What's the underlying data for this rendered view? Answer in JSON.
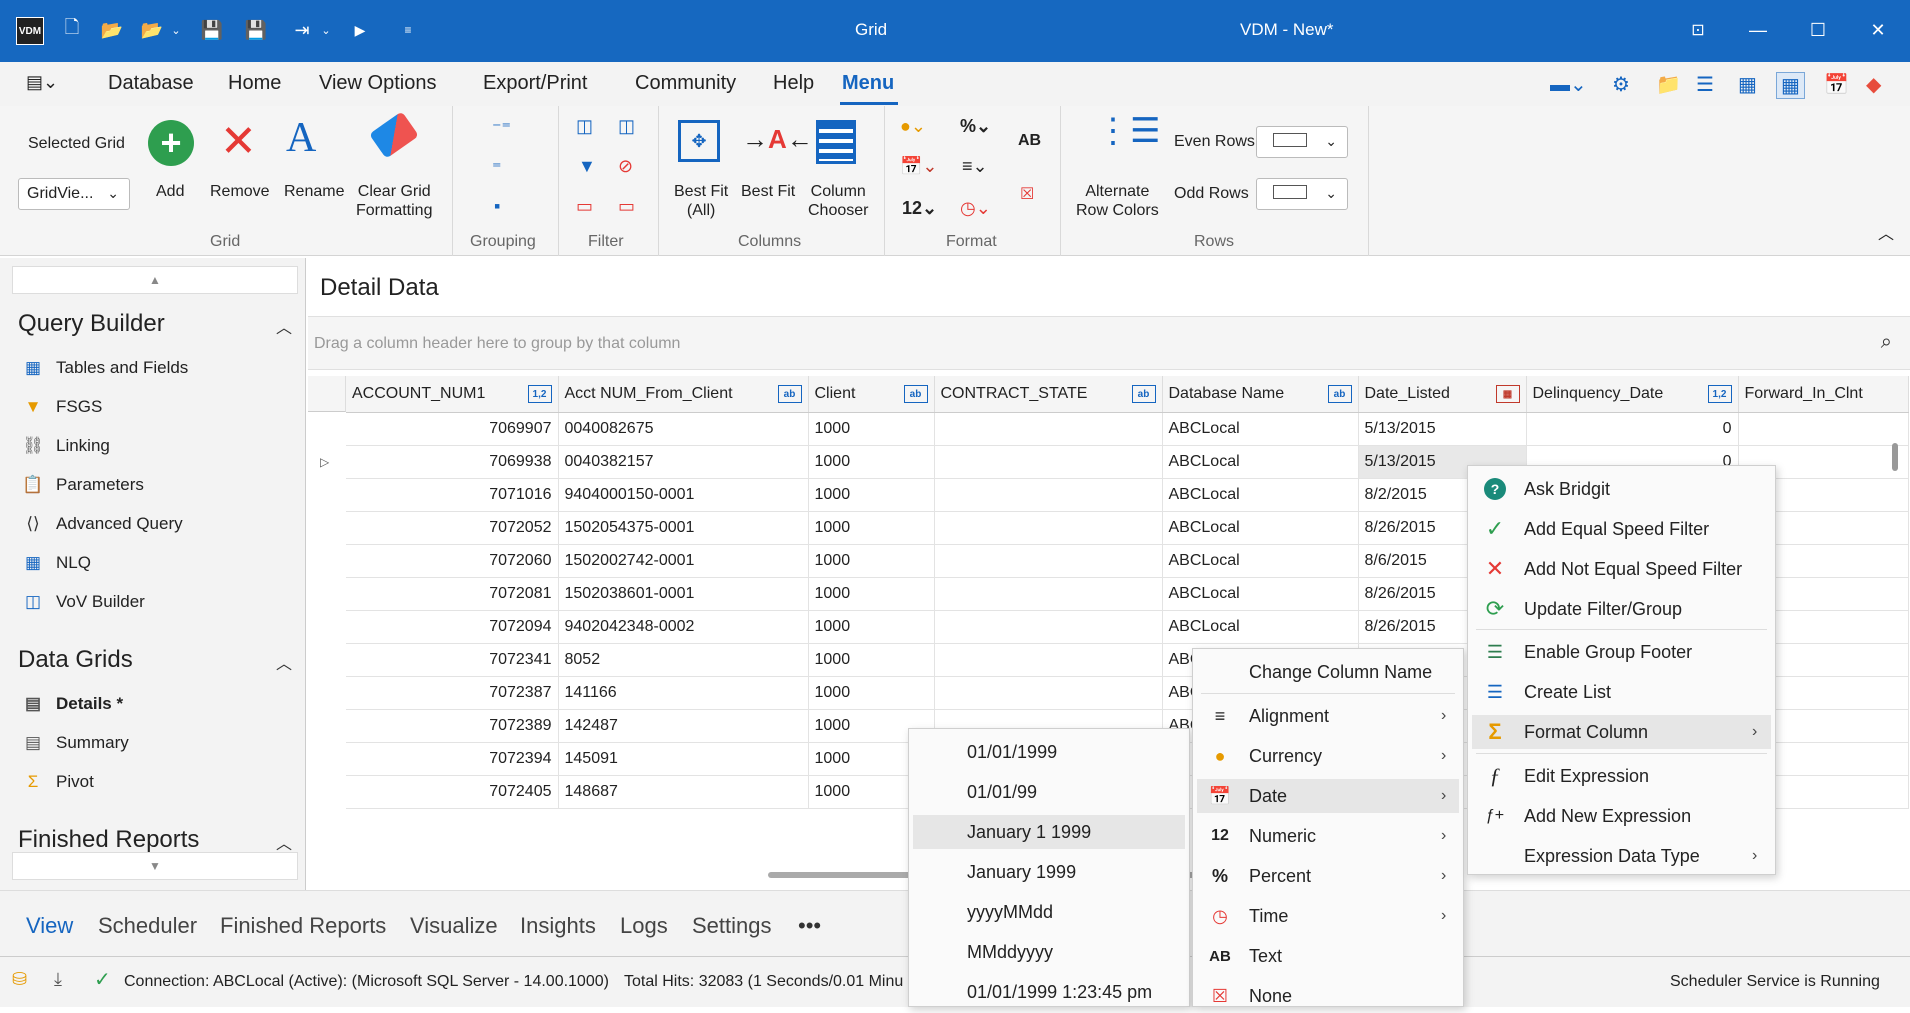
{
  "window": {
    "grid_label": "Grid",
    "title": "VDM - New*",
    "logo": "VDM"
  },
  "menu": {
    "items": [
      "Database",
      "Home",
      "View Options",
      "Export/Print",
      "Community",
      "Help",
      "Menu"
    ]
  },
  "ribbon": {
    "selected_grid_label": "Selected Grid",
    "selected_grid_value": "GridVie...",
    "add": "Add",
    "remove": "Remove",
    "rename": "Rename",
    "clear_grid_formatting_1": "Clear Grid",
    "clear_grid_formatting_2": "Formatting",
    "best_fit_all_1": "Best Fit",
    "best_fit_all_2": "(All)",
    "best_fit": "Best Fit",
    "column_chooser_1": "Column",
    "column_chooser_2": "Chooser",
    "format_12": "12",
    "format_ab": "AB",
    "alternate_1": "Alternate",
    "alternate_2": "Row Colors",
    "even_rows": "Even Rows",
    "odd_rows": "Odd Rows",
    "groups": {
      "grid": "Grid",
      "grouping": "Grouping",
      "filter": "Filter",
      "columns": "Columns",
      "format": "Format",
      "rows": "Rows"
    }
  },
  "leftpanel": {
    "query_builder": "Query Builder",
    "qb_items": [
      "Tables and Fields",
      "FSGS",
      "Linking",
      "Parameters",
      "Advanced Query",
      "NLQ",
      "VoV Builder"
    ],
    "data_grids": "Data Grids",
    "dg_items": [
      "Details *",
      "Summary",
      "Pivot"
    ],
    "finished_reports": "Finished Reports"
  },
  "main": {
    "title": "Detail Data",
    "group_hint": "Drag a column header here to group by that column",
    "columns": [
      "ACCOUNT_NUM1",
      "Acct NUM_From_Client",
      "Client",
      "CONTRACT_STATE",
      "Database Name",
      "Date_Listed",
      "Delinquency_Date",
      "Forward_In_Clnt"
    ],
    "badges": [
      "1,2",
      "ab",
      "ab",
      "ab",
      "ab",
      "cal",
      "1,2",
      ""
    ],
    "rows": [
      [
        "7069907",
        "0040082675",
        "1000",
        "",
        "ABCLocal",
        "5/13/2015",
        "0"
      ],
      [
        "7069938",
        "0040382157",
        "1000",
        "",
        "ABCLocal",
        "5/13/2015",
        "0"
      ],
      [
        "7071016",
        "9404000150-0001",
        "1000",
        "",
        "ABCLocal",
        "8/2/2015",
        ""
      ],
      [
        "7072052",
        "1502054375-0001",
        "1000",
        "",
        "ABCLocal",
        "8/26/2015",
        ""
      ],
      [
        "7072060",
        "1502002742-0001",
        "1000",
        "",
        "ABCLocal",
        "8/6/2015",
        ""
      ],
      [
        "7072081",
        "1502038601-0001",
        "1000",
        "",
        "ABCLocal",
        "8/26/2015",
        ""
      ],
      [
        "7072094",
        "9402042348-0002",
        "1000",
        "",
        "ABCLocal",
        "8/26/2015",
        ""
      ],
      [
        "7072341",
        "8052",
        "1000",
        "",
        "ABC",
        "",
        ""
      ],
      [
        "7072387",
        "141166",
        "1000",
        "",
        "ABC",
        "",
        ""
      ],
      [
        "7072389",
        "142487",
        "1000",
        "",
        "ABC",
        "",
        ""
      ],
      [
        "7072394",
        "145091",
        "1000",
        "",
        "",
        "",
        ""
      ],
      [
        "7072405",
        "148687",
        "1000",
        "",
        "",
        "",
        ""
      ]
    ]
  },
  "context_menu": {
    "items": [
      "Ask Bridgit",
      "Add Equal Speed Filter",
      "Add Not Equal Speed Filter",
      "Update Filter/Group",
      "Enable Group Footer",
      "Create List",
      "Format Column",
      "Edit Expression",
      "Add New Expression",
      "Expression Data Type"
    ]
  },
  "format_submenu": {
    "header": "Change Column Name",
    "items": [
      "Alignment",
      "Currency",
      "Date",
      "Numeric",
      "Percent",
      "Time",
      "Text",
      "None"
    ],
    "icons": [
      "",
      "",
      "",
      "12",
      "%",
      "",
      "AB",
      ""
    ]
  },
  "date_submenu": {
    "items": [
      "01/01/1999",
      "01/01/99",
      "January 1 1999",
      "January 1999",
      "yyyyMMdd",
      "MMddyyyy",
      "01/01/1999 1:23:45 pm"
    ]
  },
  "bottom_tabs": [
    "View",
    "Scheduler",
    "Finished Reports",
    "Visualize",
    "Insights",
    "Logs",
    "Settings",
    "•••"
  ],
  "status": {
    "connection": "Connection: ABCLocal (Active): (Microsoft SQL Server - 14.00.1000)",
    "hits": "Total Hits: 32083 (1 Seconds/0.01 Minu",
    "scheduler": "Scheduler Service is Running"
  },
  "colors": {
    "accent": "#1668c0",
    "highlight": "#e6e6e6"
  }
}
